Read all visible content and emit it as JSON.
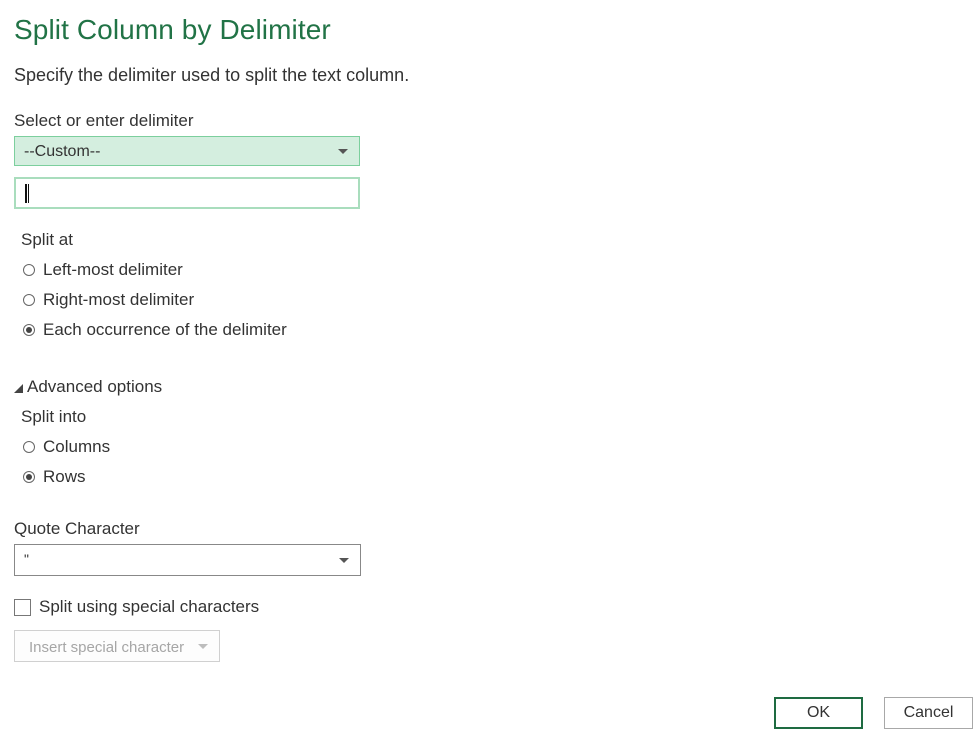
{
  "dialog": {
    "title": "Split Column by Delimiter",
    "description": "Specify the delimiter used to split the text column."
  },
  "delimiter": {
    "label": "Select or enter delimiter",
    "selected": "--Custom--",
    "custom_value": "|"
  },
  "split_at": {
    "label": "Split at",
    "options": [
      {
        "label": "Left-most delimiter",
        "checked": false
      },
      {
        "label": "Right-most delimiter",
        "checked": false
      },
      {
        "label": "Each occurrence of the delimiter",
        "checked": true
      }
    ]
  },
  "advanced": {
    "toggle_label": "Advanced options",
    "split_into_label": "Split into",
    "split_into_options": [
      {
        "label": "Columns",
        "checked": false
      },
      {
        "label": "Rows",
        "checked": true
      }
    ],
    "quote_label": "Quote Character",
    "quote_value": "\"",
    "special_chars_label": "Split using special characters",
    "special_chars_checked": false,
    "insert_special_label": "Insert special character"
  },
  "buttons": {
    "ok": "OK",
    "cancel": "Cancel"
  },
  "colors": {
    "title": "#217346",
    "combo_fill": "#d4eedf",
    "ok_border": "#1e6b41"
  },
  "icons": {
    "dropdown": "chevron-down-icon",
    "advanced_toggle": "triangle-expanded-icon"
  }
}
